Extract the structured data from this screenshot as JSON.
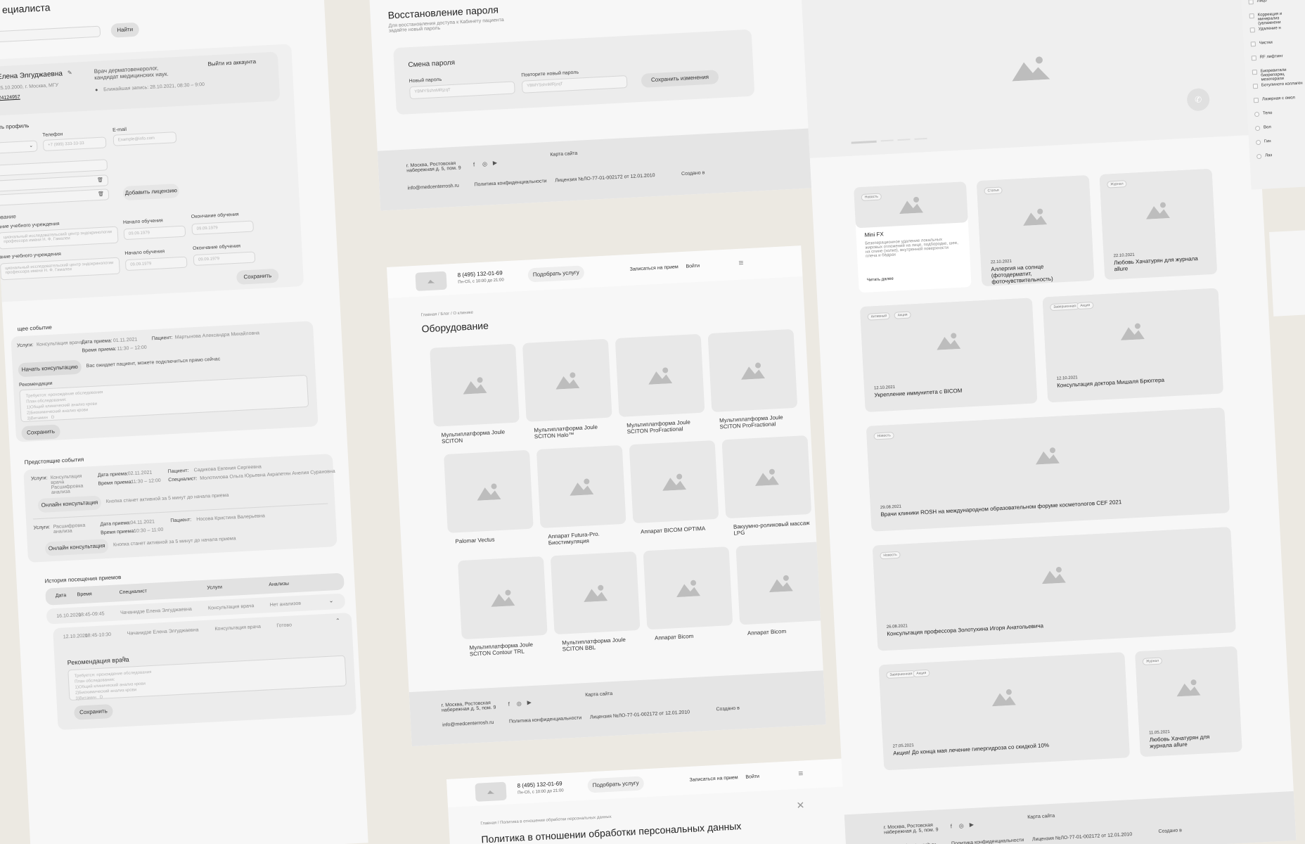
{
  "profile": {
    "title": "ециалиста",
    "search_btn": "Найти",
    "name": "Елена Элгуджаевна",
    "birth": "25.10.2000, г. Москва, МГУ",
    "phone_link": "24124957",
    "role": "Врач дерматовенеролог, кандидат медицинских наук.",
    "next_visit": "Ближайшая запись: 28.10.2021, 08:30 – 9:00",
    "logout": "Выйти из аккаунта",
    "edit_profile": "вать профиль",
    "phone_label": "Телефон",
    "email_label": "E-mail",
    "phone_ph": "+7 (999) 333-33-33",
    "email_ph": "Example@info.com",
    "add_license": "Добавить лицензию",
    "education": "ование",
    "inst_label": "ание учебного учреждения",
    "inst_value": "циональный исследовательский центр эндокринологии профессора имени Н. Ф. Гамалеи",
    "start_label": "Начало обучения",
    "end_label": "Окончание обучения",
    "date_ph": "09.09.1979",
    "save": "Сохранить"
  },
  "events": {
    "current_title": "щее событие",
    "services_label": "Услуги:",
    "service_value": "Консультация врача",
    "date_label": "Дата приема:",
    "date_value": "01.11.2021",
    "time_label": "Время приема:",
    "time_value": "11:30 – 12:00",
    "patient_label": "Пациент:",
    "patient_value": "Мартынова Александра Михайловна",
    "start_btn": "Начать консультацию",
    "waiting": "Вас ожидает пациент, можете подключиться прямо сейчас",
    "rec_label": "Рекомендации",
    "rec_lines": "Требуется: прохождение обследования\nПлан обследования:\n1)Общий клинический анализ крови\n2)Биохимический анализ крови\n3)Витамин   D",
    "save": "Сохранить",
    "upcoming_title": "Предстоящие события",
    "up1_service": "Консультация врача Расшифровка анализа",
    "up1_date": "02.11.2021",
    "up1_time": "11:30 – 12:00",
    "up1_patient": "Садикова Евгения Сергеевна",
    "spec_label": "Специалист:",
    "up1_spec": "Молотилова Ольга Юрьевна   Акрапетян Анелия Сурановна",
    "online_btn": "Онлайн консультация",
    "online_note": "Кнопка станет активной за 5 минут до начала приема",
    "up2_service": "Расшифровка анализа",
    "up2_date": "04.11.2021",
    "up2_time": "10:30 – 11:00",
    "up2_patient": "Носова Кристина Валерьевна"
  },
  "history": {
    "title": "История посещения приемов",
    "cols": [
      "Дата",
      "Время",
      "Специалист",
      "Услуги",
      "Анализы"
    ],
    "rows": [
      [
        "16.10.2021",
        "08:45-09:45",
        "Чачанидзе Елена Элгуджаевна",
        "Консультация врача",
        "Нет анализов"
      ],
      [
        "12.10.2021",
        "08:45-10:30",
        "Чачанидзе Елена Элгуджаевна",
        "Консультация врача",
        "Готово"
      ]
    ],
    "rec_title": "Рекомендация врача",
    "save": "Сохранить"
  },
  "recovery": {
    "title": "Восстановление пароля",
    "subtitle": "Для восстановления доступа к Кабинету пациента задайте новый пароль",
    "box_title": "Смена пароля",
    "new_label": "Новый пароль",
    "repeat_label": "Повторите новый пароль",
    "pw_ph": "YBMYSshnMRjzqT",
    "save_btn": "Сохранить изменения"
  },
  "footer": {
    "address": "г. Москва, Ростовская набережная д. 5, пом. 9",
    "email": "info@medcenterrosh.ru",
    "sitemap": "Карта сайта",
    "privacy": "Политика конфиденциальности",
    "license": "Лицензия №ЛО-77-01-002172 от 12.01.2010",
    "created": "Создано в"
  },
  "header": {
    "phone": "8 (495) 132-01-69",
    "hours": "Пн-Сб, с 10:00 до 21:00",
    "pick": "Подобрать услугу",
    "signup": "Записаться на прием",
    "login": "Войти"
  },
  "equipment": {
    "breadcrumb": "Главная / Блог / О клинике",
    "title": "Оборудование",
    "items": [
      "Мультиплатформа Joule SCITON",
      "Мультиплатформа Joule SCITON Halo™",
      "Мультиплатформа Joule SCITON ProFractional",
      "Мультиплатформа Joule SCITON ProFractional",
      "Palomar Vectus",
      "Аппарат Futura-Pro. Биостимуляция",
      "Аппарат BICOM OPTIMA",
      "Вакуумно-роликовый массаж LPG",
      "Мультиплатформа Joule SCITON Contour TRL",
      "Мультиплатформа Joule SCITON BBL",
      "Аппарат Bicom",
      "Аппарат Bicom"
    ]
  },
  "policy": {
    "breadcrumb": "Главная / Политика в отношении обработки персональных данных",
    "title": "Политика в отношении обработки персональных данных"
  },
  "blog": {
    "cards": [
      {
        "tag": "Новость",
        "title": "Mini FX",
        "text": "Безоперационное удаление локальных жировых отложений на лице, подбородке, шее, на спине (холке), внутренней поверхности плеча и бёдрах",
        "more": "Читать далее"
      },
      {
        "tag": "Статья",
        "date": "22.10.2021",
        "title": "Аллергия на солнце (фотодерматит, фоточувствительность)"
      },
      {
        "tag": "Журнал",
        "date": "22.10.2021",
        "title": "Любовь Хачатурян для журнала allure"
      },
      {
        "tags": [
          "Активный",
          "Акция"
        ],
        "date": "12.10.2021",
        "title": "Укрепление иммунитета с BICOM"
      },
      {
        "tags": [
          "Завершенная",
          "Акция"
        ],
        "date": "12.10.2021",
        "title": "Консультация доктора Мишаля Брюггера"
      },
      {
        "tag": "Новость",
        "date": "29.08.2021",
        "title": "Врачи клиники ROSH на международном образовательном форуме косметологов CEF 2021"
      },
      {
        "tag": "Новость",
        "date": "26.08.2021",
        "title": "Консультация профессора Золотухина Игоря Анатольевича"
      },
      {
        "tags": [
          "Завершенная",
          "Акция"
        ],
        "date": "27.05.2021",
        "title": "Акция! До конца мая лечение гипергидроза со скидкой 10%"
      },
      {
        "tag": "Журнал",
        "date": "11.05.2021",
        "title": "Любовь Хачатурян для журнала allure"
      }
    ]
  },
  "filters": {
    "items": [
      "Лицо",
      "Коррекция и минерализ (увлажнени",
      "Удаление н",
      "Чистки",
      "RF лифтинг",
      "Биоревитали биорепарац мезотерапи",
      "Ботулиното коллаген",
      "Лазерная с омол",
      "Тело",
      "Вол",
      "Гин",
      "Лаз"
    ]
  }
}
